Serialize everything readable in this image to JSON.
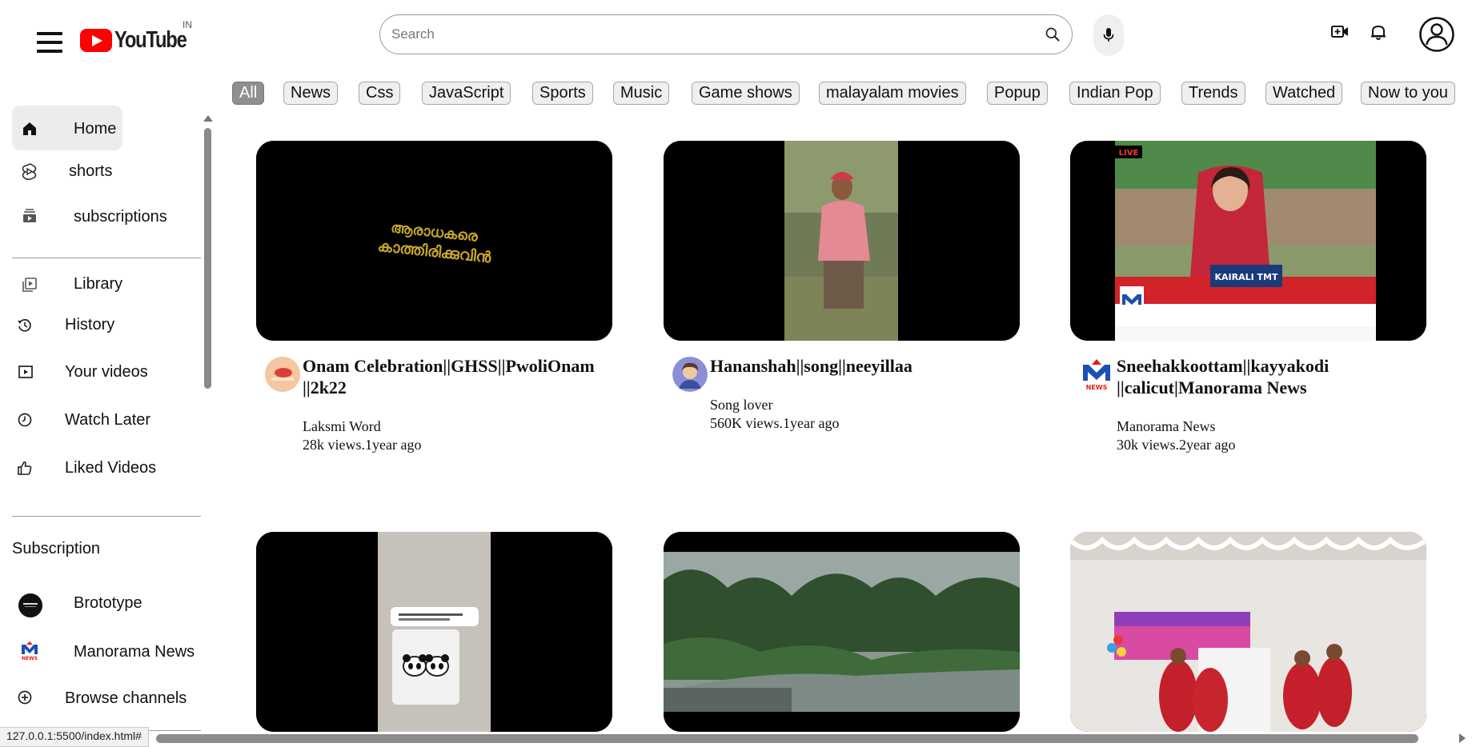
{
  "header": {
    "logo_text": "YouTube",
    "country": "IN",
    "search_placeholder": "Search"
  },
  "sidebar": {
    "items": [
      {
        "label": "Home",
        "icon": "home-icon"
      },
      {
        "label": "shorts",
        "icon": "shorts-icon"
      },
      {
        "label": "subscriptions",
        "icon": "subscriptions-icon"
      },
      {
        "label": "Library",
        "icon": "library-icon"
      },
      {
        "label": "History",
        "icon": "history-icon"
      },
      {
        "label": "Your videos",
        "icon": "your-videos-icon"
      },
      {
        "label": "Watch Later",
        "icon": "clock-icon"
      },
      {
        "label": "Liked Videos",
        "icon": "thumbs-up-icon"
      }
    ],
    "subscription_heading": "Subscription",
    "channels": [
      {
        "label": "Brototype"
      },
      {
        "label": "Manorama News"
      }
    ],
    "browse_label": "Browse channels"
  },
  "chips": [
    "All",
    "News",
    "Css",
    "JavaScript",
    "Sports",
    "Music",
    "Game shows",
    "malayalam movies",
    "Popup",
    "Indian Pop",
    "Trends",
    "Watched",
    "Now to you"
  ],
  "videos": [
    {
      "title": "Onam Celebration||GHSS||PwoliOnam ||2k22",
      "channel": "Laksmi Word",
      "stats": "28k views.1year ago",
      "thumb_text": "ആരാധകരെ കാത്തിരിക്കുവിൻ"
    },
    {
      "title": "Hananshah||song||neeyillaa",
      "channel": "Song lover",
      "stats": "560K views.1year ago"
    },
    {
      "title": "Sneehakkoottam||kayyakodi ||calicut|Manorama News",
      "channel": "Manorama News",
      "stats": "30k views.2year ago",
      "live": "LIVE",
      "banner": "KAIRALI TMT"
    },
    {
      "title": "",
      "channel": "",
      "stats": ""
    },
    {
      "title": "",
      "channel": "",
      "stats": ""
    },
    {
      "title": "",
      "channel": "",
      "stats": ""
    }
  ],
  "status_url": "127.0.0.1:5500/index.html#",
  "colors": {
    "brand_red": "#ff0000",
    "chip_active": "#8f8f8f",
    "chip_bg": "#efefef",
    "sidebar_active": "#ececec"
  }
}
